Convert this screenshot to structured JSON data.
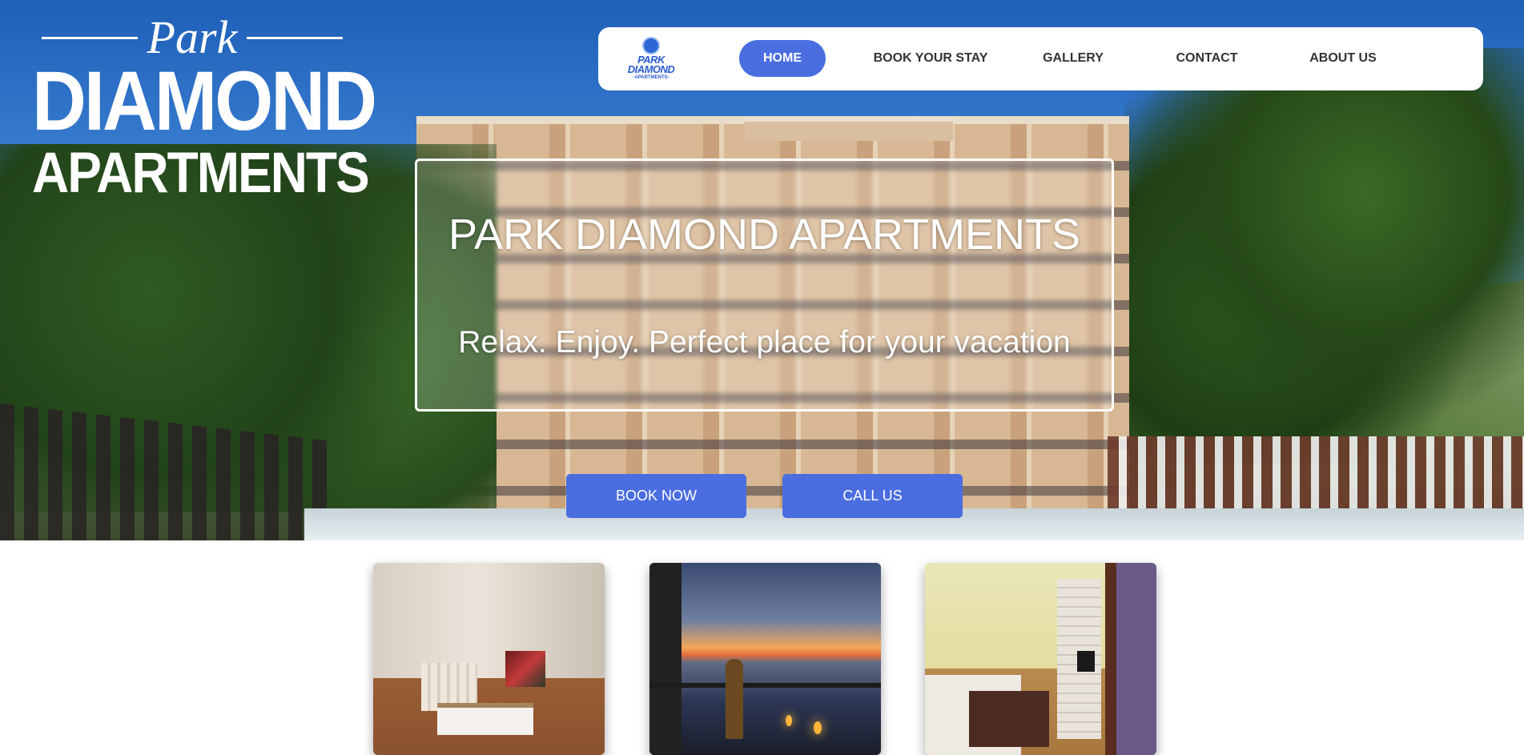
{
  "brand": {
    "logo_park": "Park",
    "logo_diamond": "DIAMOND",
    "logo_apartments": "APARTMENTS",
    "nav_logo_line1": "PARK",
    "nav_logo_line2": "DIAMOND",
    "nav_logo_line3": "-APARTMENTS-"
  },
  "nav": {
    "items": [
      {
        "label": "HOME",
        "active": true
      },
      {
        "label": "BOOK YOUR STAY",
        "active": false
      },
      {
        "label": "GALLERY",
        "active": false
      },
      {
        "label": "CONTACT",
        "active": false
      },
      {
        "label": "ABOUT US",
        "active": false
      }
    ]
  },
  "hero": {
    "title": "PARK DIAMOND APARTMENTS",
    "subtitle": "Relax. Enjoy. Perfect place for your vacation"
  },
  "cta": {
    "book_label": "BOOK NOW",
    "call_label": "CALL US"
  },
  "colors": {
    "accent": "#4a6de0",
    "nav_text": "#333333"
  }
}
